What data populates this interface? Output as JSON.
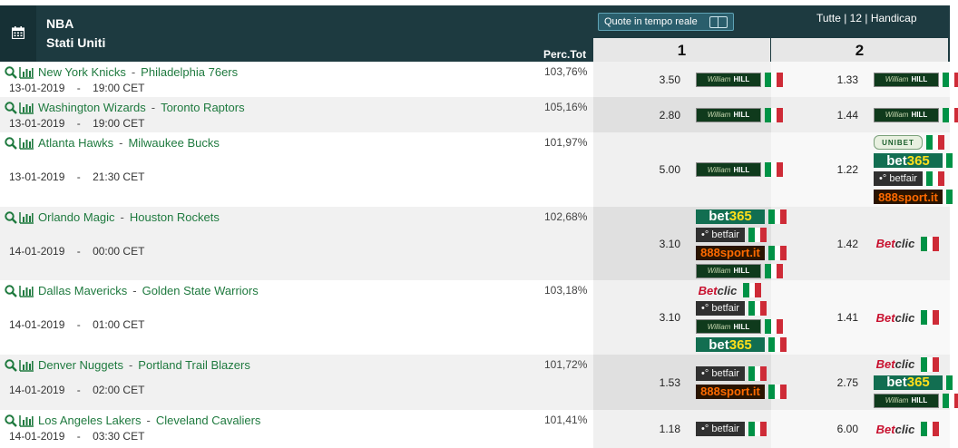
{
  "header": {
    "league": "NBA",
    "country": "Stati Uniti",
    "perc_header": "Perc.Tot",
    "realtime_label": "Quote in tempo reale",
    "filters": "Tutte | 12 | Handicap",
    "col1": "1",
    "col2": "2"
  },
  "colors": {
    "header_bg": "#1d3a40",
    "team_link": "#1f7a3f",
    "row_alt": "#f1f1f1"
  },
  "matches": [
    {
      "home": "New York Knicks",
      "away": "Philadelphia 76ers",
      "date": "13-01-2019",
      "time": "19:00 CET",
      "perc": "103,76%",
      "odd1": "3.50",
      "odd2": "1.33",
      "bk1": [
        "william-hill"
      ],
      "bk2": [
        "william-hill"
      ]
    },
    {
      "home": "Washington Wizards",
      "away": "Toronto Raptors",
      "date": "13-01-2019",
      "time": "19:00 CET",
      "perc": "105,16%",
      "odd1": "2.80",
      "odd2": "1.44",
      "bk1": [
        "william-hill"
      ],
      "bk2": [
        "william-hill"
      ]
    },
    {
      "home": "Atlanta Hawks",
      "away": "Milwaukee Bucks",
      "date": "13-01-2019",
      "time": "21:30 CET",
      "perc": "101,97%",
      "odd1": "5.00",
      "odd2": "1.22",
      "bk1": [
        "william-hill"
      ],
      "bk2": [
        "unibet",
        "bet365",
        "betfair",
        "888sport"
      ]
    },
    {
      "home": "Orlando Magic",
      "away": "Houston Rockets",
      "date": "14-01-2019",
      "time": "00:00 CET",
      "perc": "102,68%",
      "odd1": "3.10",
      "odd2": "1.42",
      "bk1": [
        "bet365",
        "betfair",
        "888sport",
        "william-hill"
      ],
      "bk2": [
        "betclic"
      ]
    },
    {
      "home": "Dallas Mavericks",
      "away": "Golden State Warriors",
      "date": "14-01-2019",
      "time": "01:00 CET",
      "perc": "103,18%",
      "odd1": "3.10",
      "odd2": "1.41",
      "bk1": [
        "betclic",
        "betfair",
        "william-hill",
        "bet365"
      ],
      "bk2": [
        "betclic"
      ]
    },
    {
      "home": "Denver Nuggets",
      "away": "Portland Trail Blazers",
      "date": "14-01-2019",
      "time": "02:00 CET",
      "perc": "101,72%",
      "odd1": "1.53",
      "odd2": "2.75",
      "bk1": [
        "betfair",
        "888sport"
      ],
      "bk2": [
        "betclic",
        "bet365",
        "william-hill"
      ]
    },
    {
      "home": "Los Angeles Lakers",
      "away": "Cleveland Cavaliers",
      "date": "14-01-2019",
      "time": "03:30 CET",
      "perc": "101,41%",
      "odd1": "1.18",
      "odd2": "6.00",
      "bk1": [
        "betfair"
      ],
      "bk2": [
        "betclic"
      ]
    }
  ],
  "bookmakers": {
    "william-hill": {
      "a": "William",
      "b": "HILL"
    },
    "bet365": {
      "a": "bet",
      "b": "365"
    },
    "betfair": {
      "a": "•° betfair"
    },
    "888sport": {
      "a": "888sport.it"
    },
    "betclic": {
      "a": "Bet",
      "b": "clic"
    },
    "unibet": {
      "a": "UNIBET"
    }
  }
}
